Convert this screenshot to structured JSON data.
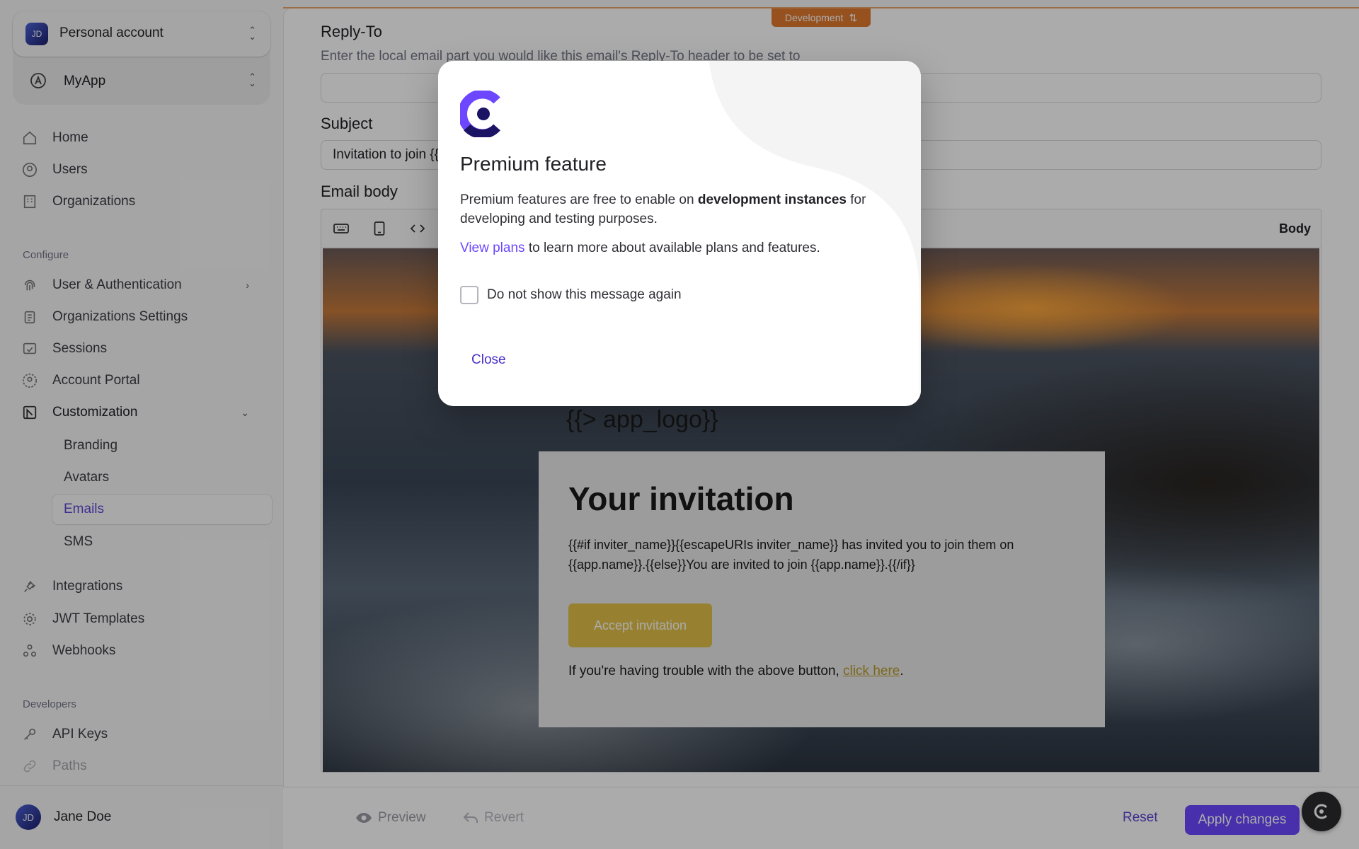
{
  "environment_badge": "Development",
  "sidebar": {
    "account_label": "Personal account",
    "account_initials": "JD",
    "app_label": "MyApp",
    "main_items": [
      {
        "label": "Home"
      },
      {
        "label": "Users"
      },
      {
        "label": "Organizations"
      }
    ],
    "configure_label": "Configure",
    "configure_items": [
      {
        "label": "User & Authentication"
      },
      {
        "label": "Organizations Settings"
      },
      {
        "label": "Sessions"
      },
      {
        "label": "Account Portal"
      },
      {
        "label": "Customization"
      }
    ],
    "customization_sub": [
      {
        "label": "Branding"
      },
      {
        "label": "Avatars"
      },
      {
        "label": "Emails"
      },
      {
        "label": "SMS"
      }
    ],
    "more_items": [
      {
        "label": "Integrations"
      },
      {
        "label": "JWT Templates"
      },
      {
        "label": "Webhooks"
      }
    ],
    "developers_label": "Developers",
    "developer_items": [
      {
        "label": "API Keys"
      },
      {
        "label": "Paths"
      }
    ],
    "user_name": "Jane Doe",
    "user_initials": "JD"
  },
  "form": {
    "reply_to_label": "Reply-To",
    "reply_to_desc": "Enter the local email part you would like this email's Reply-To header to be set to",
    "reply_to_value": "",
    "subject_label": "Subject",
    "subject_value": "Invitation to join {{",
    "body_label": "Email body",
    "body_mode": "Body"
  },
  "email_preview": {
    "logo_placeholder": "{{> app_logo}}",
    "heading": "Your invitation",
    "paragraph": "{{#if inviter_name}}{{escapeURIs inviter_name}} has invited you to join them on {{app.name}}.{{else}}You are invited to join {{app.name}}.{{/if}}",
    "button": "Accept invitation",
    "trouble_prefix": "If you're having trouble with the above button, ",
    "trouble_link": "click here",
    "trouble_suffix": "."
  },
  "footer": {
    "preview": "Preview",
    "revert": "Revert",
    "reset": "Reset",
    "apply": "Apply changes"
  },
  "modal": {
    "title": "Premium feature",
    "text_before": "Premium features are free to enable on ",
    "text_bold": "development instances",
    "text_after": " for developing and testing purposes.",
    "plans_link": "View plans",
    "plans_rest": " to learn more about available plans and features.",
    "checkbox_label": "Do not show this message again",
    "checkbox_checked": false,
    "close": "Close"
  },
  "colors": {
    "accent": "#6c47ff",
    "dev_badge": "#e07a2e",
    "email_button": "#e2c04a"
  }
}
